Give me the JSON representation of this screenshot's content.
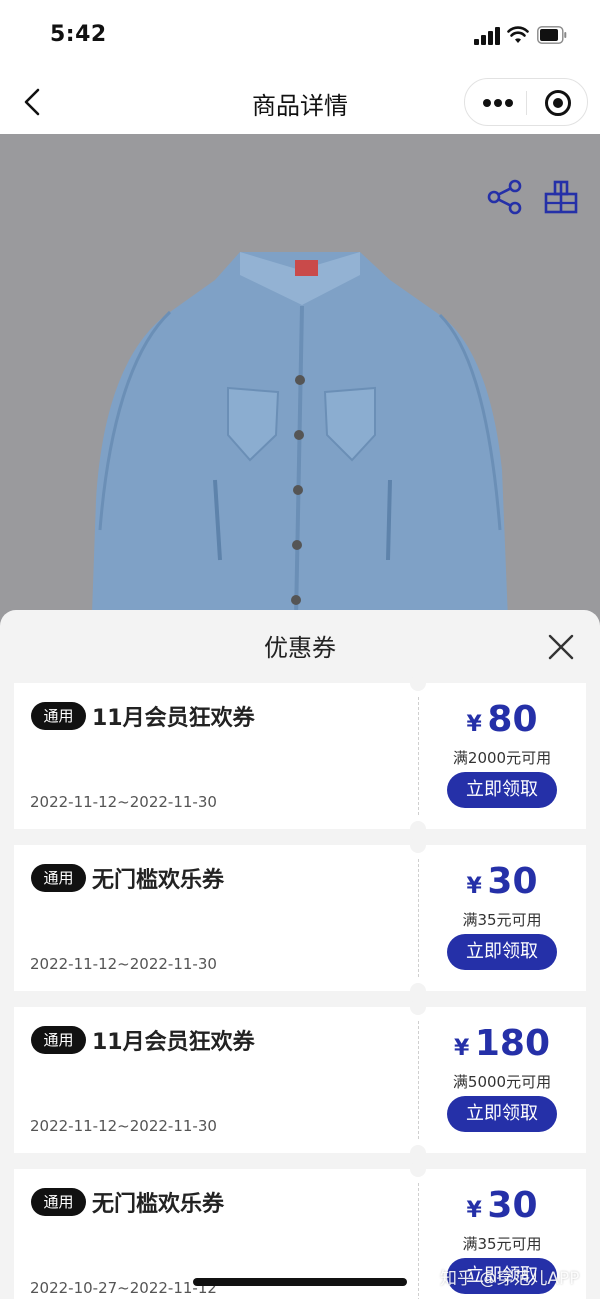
{
  "status_bar": {
    "time": "5:42"
  },
  "nav": {
    "title": "商品详情"
  },
  "sheet": {
    "title": "优惠券",
    "coupons": [
      {
        "badge": "通用",
        "name": "11月会员狂欢券",
        "date": "2022-11-12~2022-11-30",
        "currency": "¥",
        "amount": "80",
        "condition": "满2000元可用",
        "button": "立即领取"
      },
      {
        "badge": "通用",
        "name": "无门槛欢乐券",
        "date": "2022-11-12~2022-11-30",
        "currency": "¥",
        "amount": "30",
        "condition": "满35元可用",
        "button": "立即领取"
      },
      {
        "badge": "通用",
        "name": "11月会员狂欢券",
        "date": "2022-11-12~2022-11-30",
        "currency": "¥",
        "amount": "180",
        "condition": "满5000元可用",
        "button": "立即领取"
      },
      {
        "badge": "通用",
        "name": "无门槛欢乐券",
        "date": "2022-10-27~2022-11-12",
        "currency": "¥",
        "amount": "30",
        "condition": "满35元可用",
        "button": "立即领取"
      }
    ]
  },
  "watermark": "知乎 @穿范儿APP",
  "colors": {
    "accent": "#2530a8",
    "badge_bg": "#111111",
    "image_bg": "#9a9a9d",
    "sheet_bg": "#f3f3f3"
  },
  "icons": [
    "back-chevron-icon",
    "more-dots-icon",
    "target-icon",
    "share-icon",
    "gift-box-icon",
    "close-icon"
  ]
}
